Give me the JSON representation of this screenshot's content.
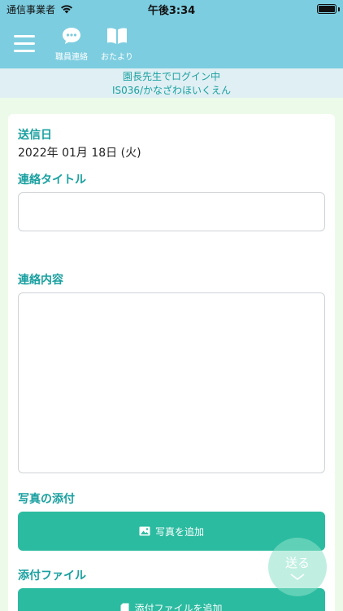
{
  "status_bar": {
    "carrier": "通信事業者",
    "time": "午後3:34"
  },
  "header": {
    "nav": [
      {
        "label": "職員連絡",
        "icon": "chat-bubble-icon"
      },
      {
        "label": "おたより",
        "icon": "book-icon"
      }
    ]
  },
  "login_info": {
    "line1": "園長先生でログイン中",
    "line2": "IS036/かなざわほいくえん"
  },
  "form": {
    "send_date_label": "送信日",
    "send_date_value": "2022年 01月 18日 (火)",
    "title_label": "連絡タイトル",
    "title_value": "",
    "content_label": "連絡内容",
    "content_value": "",
    "photo_label": "写真の添付",
    "photo_button": "写真を追加",
    "file_label": "添付ファイル",
    "file_button": "添付ファイルを追加"
  },
  "send_button": {
    "label": "送る"
  },
  "colors": {
    "header_bg": "#7dcde0",
    "accent": "#1aa0a0",
    "button": "#2bbba0",
    "page_bg": "#ecfbe9"
  }
}
